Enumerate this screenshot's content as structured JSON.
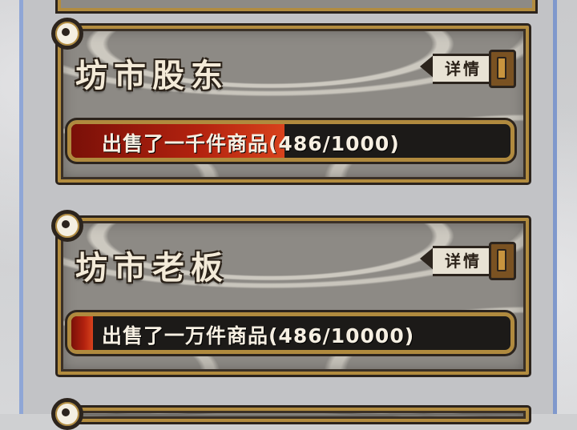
{
  "cards": [
    {
      "title": "坊市股东",
      "details_label": "详情",
      "progress_label": "出售了一千件商品(486/1000)",
      "progress_current": 486,
      "progress_total": 1000,
      "progress_fraction": 0.486
    },
    {
      "title": "坊市老板",
      "details_label": "详情",
      "progress_label": "出售了一万件商品(486/10000)",
      "progress_current": 486,
      "progress_total": 10000,
      "progress_fraction": 0.0486
    }
  ],
  "colors": {
    "frame_gold": "#b28c3f",
    "frame_dark": "#2c241d",
    "progress_fill": "#b3220f",
    "title_text": "#f3ead8",
    "side_line": "#8fa6d6"
  },
  "icons": [
    "pin-icon",
    "sword-hilt-icon"
  ]
}
